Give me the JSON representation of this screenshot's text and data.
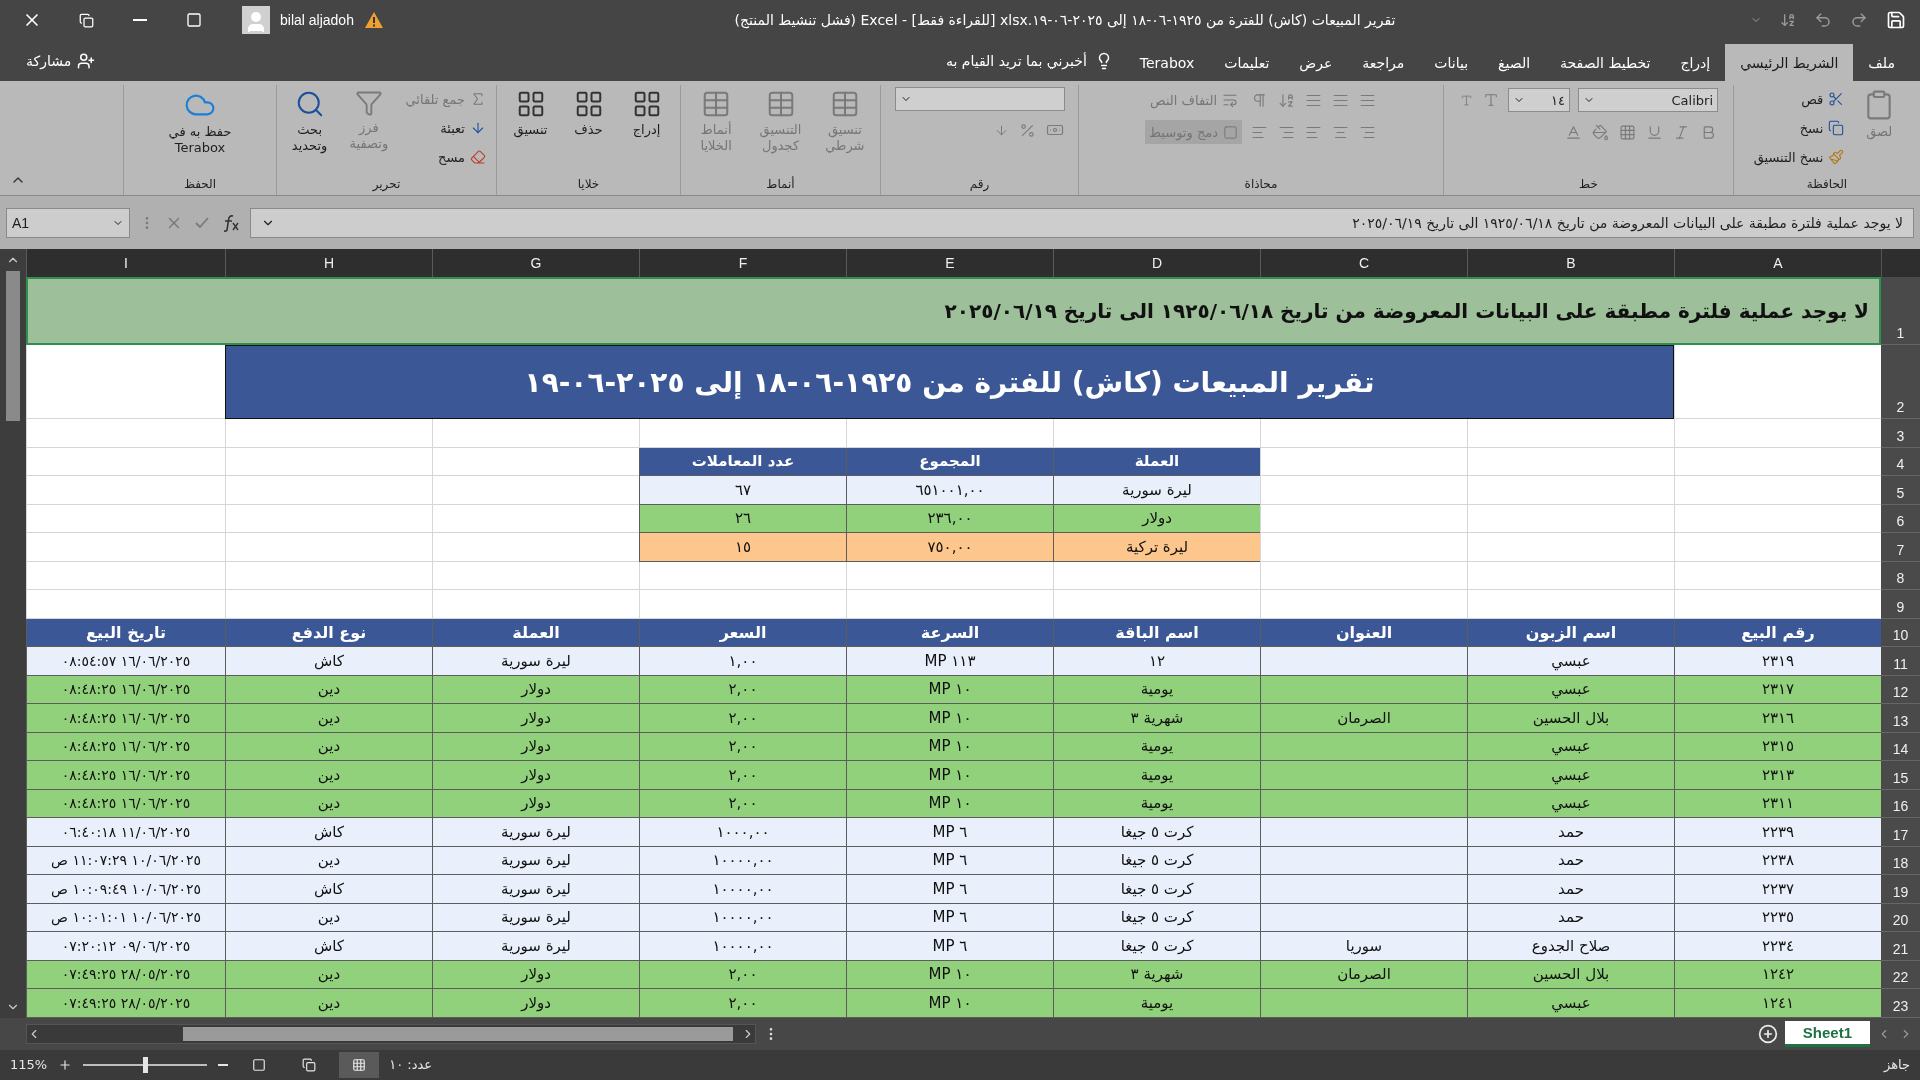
{
  "window": {
    "title": "تقرير المبيعات (كاش) للفترة من ١٩٢٥-٠٦-١٨ إلى ٢٠٢٥-٠٦-١٩.xlsx [للقراءة فقط] - Excel (فشل تنشيط المنتج)",
    "user": "bilal aljadoh"
  },
  "share": "مشاركة",
  "tell_me": "أخبرني بما تريد القيام به",
  "tabs": [
    {
      "label": "ملف",
      "selected": false
    },
    {
      "label": "الشريط الرئيسي",
      "selected": true
    },
    {
      "label": "إدراج",
      "selected": false
    },
    {
      "label": "تخطيط الصفحة",
      "selected": false
    },
    {
      "label": "الصيغ",
      "selected": false
    },
    {
      "label": "بيانات",
      "selected": false
    },
    {
      "label": "مراجعة",
      "selected": false
    },
    {
      "label": "عرض",
      "selected": false
    },
    {
      "label": "تعليمات",
      "selected": false
    },
    {
      "label": "Terabox",
      "selected": false
    }
  ],
  "ribbon": {
    "groups": [
      {
        "kind": "clipboard",
        "name": "الحافظة",
        "buttons": [
          {
            "label": "لصق",
            "disabled": true
          },
          {
            "label": "قص",
            "disabled": false
          },
          {
            "label": "نسخ",
            "disabled": false
          },
          {
            "label": "نسخ التنسيق",
            "disabled": false
          }
        ]
      },
      {
        "kind": "font",
        "name": "خط",
        "fields": [
          {
            "value": "Calibri"
          },
          {
            "value": "١٤"
          }
        ]
      },
      {
        "kind": "alignment",
        "name": "محاذاة",
        "buttons": [
          {
            "label": "التفاف النص",
            "disabled": true
          },
          {
            "label": "دمج وتوسيط",
            "disabled": true
          }
        ]
      },
      {
        "kind": "number",
        "name": "رقم"
      },
      {
        "kind": "styles",
        "name": "أنماط",
        "buttons": [
          {
            "label": "تنسيق شرطي",
            "disabled": true
          },
          {
            "label": "التنسيق كجدول",
            "disabled": true
          },
          {
            "label": "أنماط الخلايا",
            "disabled": true
          }
        ]
      },
      {
        "kind": "cells",
        "name": "خلايا",
        "buttons": [
          {
            "label": "إدراج",
            "disabled": false
          },
          {
            "label": "حذف",
            "disabled": false
          },
          {
            "label": "تنسيق",
            "disabled": false
          }
        ]
      },
      {
        "kind": "editing",
        "name": "تحرير",
        "buttons": [
          {
            "label": "جمع تلقائي",
            "disabled": true
          },
          {
            "label": "تعبئة",
            "disabled": false
          },
          {
            "label": "مسح",
            "disabled": false
          },
          {
            "label": "فرز وتصفية",
            "disabled": true
          },
          {
            "label": "بحث وتحديد",
            "disabled": false
          }
        ]
      },
      {
        "kind": "save",
        "name": "الحفظ",
        "buttons": [
          {
            "label": "حفظ به في Terabox",
            "disabled": false
          }
        ]
      }
    ]
  },
  "formula_bar": {
    "name_box": "A1",
    "content": "لا يوجد عملية فلترة مطبقة على البيانات المعروضة من تاريخ ١٩٢٥/٠٦/١٨ الى تاريخ ٢٠٢٥/٠٦/١٩"
  },
  "sheet": {
    "columns": [
      "A",
      "B",
      "C",
      "D",
      "E",
      "F",
      "G",
      "H",
      "I"
    ],
    "row_numbers": [
      "1",
      "2",
      "3",
      "4",
      "5",
      "6",
      "7",
      "8",
      "9",
      "10",
      "11",
      "12",
      "13",
      "14",
      "15",
      "16",
      "17",
      "18",
      "19",
      "20",
      "21",
      "22",
      "23"
    ],
    "filter_notice": "لا يوجد عملية فلترة مطبقة على البيانات المعروضة من تاريخ ١٩٢٥/٠٦/١٨ الى تاريخ ٢٠٢٥/٠٦/١٩",
    "report_title": "تقرير المبيعات (كاش) للفترة من ١٩٢٥-٠٦-١٨ إلى ٢٠٢٥-٠٦-١٩",
    "summary": {
      "columns": [
        "العملة",
        "المجموع",
        "عدد المعاملات"
      ],
      "rows": [
        {
          "currency": "ليرة سورية",
          "total": "٦٥١٠٠١,٠٠",
          "count": "٦٧",
          "color": "#e9f0fb"
        },
        {
          "currency": "دولار",
          "total": "٢٣٦,٠٠",
          "count": "٢٦",
          "color": "#92d17b"
        },
        {
          "currency": "ليرة تركية",
          "total": "٧٥٠,٠٠",
          "count": "١٥",
          "color": "#fcc68c"
        }
      ]
    },
    "sales": {
      "columns": [
        "رقم البيع",
        "اسم الزبون",
        "العنوان",
        "اسم الباقة",
        "السرعة",
        "السعر",
        "العملة",
        "نوع الدفع",
        "تاريخ البيع"
      ],
      "rows": [
        {
          "sale_no": "٢٣١٩",
          "customer": "عبسي",
          "package": "١٢",
          "speed": "١١٣ MP",
          "price": "١,٠٠",
          "currency": "ليرة سورية",
          "payment": "كاش",
          "date": "١٦/٠٦/٢٠٢٥ ٠٨:٥٤:٥٧",
          "color": "#e9f0fb"
        },
        {
          "sale_no": "٢٣١٧",
          "customer": "عبسي",
          "package": "يومية",
          "speed": "١٠ MP",
          "price": "٢,٠٠",
          "currency": "دولار",
          "payment": "دين",
          "date": "١٦/٠٦/٢٠٢٥ ٠٨:٤٨:٢٥",
          "color": "#92d17b"
        },
        {
          "sale_no": "٢٣١٦",
          "customer": "بلال الحسين",
          "address": "الصرمان",
          "package": "شهرية ٣",
          "speed": "١٠ MP",
          "price": "٢,٠٠",
          "currency": "دولار",
          "payment": "دين",
          "date": "١٦/٠٦/٢٠٢٥ ٠٨:٤٨:٢٥",
          "color": "#92d17b"
        },
        {
          "sale_no": "٢٣١٥",
          "customer": "عبسي",
          "package": "يومية",
          "speed": "١٠ MP",
          "price": "٢,٠٠",
          "currency": "دولار",
          "payment": "دين",
          "date": "١٦/٠٦/٢٠٢٥ ٠٨:٤٨:٢٥",
          "color": "#92d17b"
        },
        {
          "sale_no": "٢٣١٣",
          "customer": "عبسي",
          "package": "يومية",
          "speed": "١٠ MP",
          "price": "٢,٠٠",
          "currency": "دولار",
          "payment": "دين",
          "date": "١٦/٠٦/٢٠٢٥ ٠٨:٤٨:٢٥",
          "color": "#92d17b"
        },
        {
          "sale_no": "٢٣١١",
          "customer": "عبسي",
          "package": "يومية",
          "speed": "١٠ MP",
          "price": "٢,٠٠",
          "currency": "دولار",
          "payment": "دين",
          "date": "١٦/٠٦/٢٠٢٥ ٠٨:٤٨:٢٥",
          "color": "#92d17b"
        },
        {
          "sale_no": "٢٢٣٩",
          "customer": "حمد",
          "package": "كرت ٥ جيغا",
          "speed": "٦ MP",
          "price": "١٠٠٠,٠٠",
          "currency": "ليرة سورية",
          "payment": "كاش",
          "date": "١١/٠٦/٢٠٢٥ ٠٦:٤٠:١٨",
          "color": "#e9f0fb"
        },
        {
          "sale_no": "٢٢٣٨",
          "customer": "حمد",
          "package": "كرت ٥ جيغا",
          "speed": "٦ MP",
          "price": "١٠٠٠٠,٠٠",
          "currency": "ليرة سورية",
          "payment": "دين",
          "date": "١٠/٠٦/٢٠٢٥ ١١:٠٧:٢٩ ص",
          "color": "#e9f0fb"
        },
        {
          "sale_no": "٢٢٣٧",
          "customer": "حمد",
          "package": "كرت ٥ جيغا",
          "speed": "٦ MP",
          "price": "١٠٠٠٠,٠٠",
          "currency": "ليرة سورية",
          "payment": "كاش",
          "date": "١٠/٠٦/٢٠٢٥ ١٠:٠٩:٤٩ ص",
          "color": "#e9f0fb"
        },
        {
          "sale_no": "٢٢٣٥",
          "customer": "حمد",
          "package": "كرت ٥ جيغا",
          "speed": "٦ MP",
          "price": "١٠٠٠٠,٠٠",
          "currency": "ليرة سورية",
          "payment": "دين",
          "date": "١٠/٠٦/٢٠٢٥ ١٠:٠١:٠١ ص",
          "color": "#e9f0fb"
        },
        {
          "sale_no": "٢٢٣٤",
          "customer": "صلاح الجدوع",
          "address": "سوريا",
          "package": "كرت ٥ جيغا",
          "speed": "٦ MP",
          "price": "١٠٠٠٠,٠٠",
          "currency": "ليرة سورية",
          "payment": "كاش",
          "date": "٠٩/٠٦/٢٠٢٥ ٠٧:٢٠:١٢",
          "color": "#e9f0fb"
        },
        {
          "sale_no": "١٢٤٢",
          "customer": "بلال الحسين",
          "address": "الصرمان",
          "package": "شهرية ٣",
          "speed": "١٠ MP",
          "price": "٢,٠٠",
          "currency": "دولار",
          "payment": "دين",
          "date": "٢٨/٠٥/٢٠٢٥ ٠٧:٤٩:٢٥",
          "color": "#92d17b"
        },
        {
          "sale_no": "١٢٤١",
          "customer": "عبسي",
          "package": "يومية",
          "speed": "١٠ MP",
          "price": "٢,٠٠",
          "currency": "دولار",
          "payment": "دين",
          "date": "٢٨/٠٥/٢٠٢٥ ٠٧:٤٩:٢٥",
          "color": "#92d17b"
        }
      ]
    }
  },
  "sheet_tabs": [
    {
      "label": "Sheet1",
      "selected": true
    }
  ],
  "status_bar": {
    "state": "جاهز",
    "count": "عدد: ١٠",
    "zoom": "115%",
    "zoom_slider": {
      "level": 0.5
    }
  }
}
